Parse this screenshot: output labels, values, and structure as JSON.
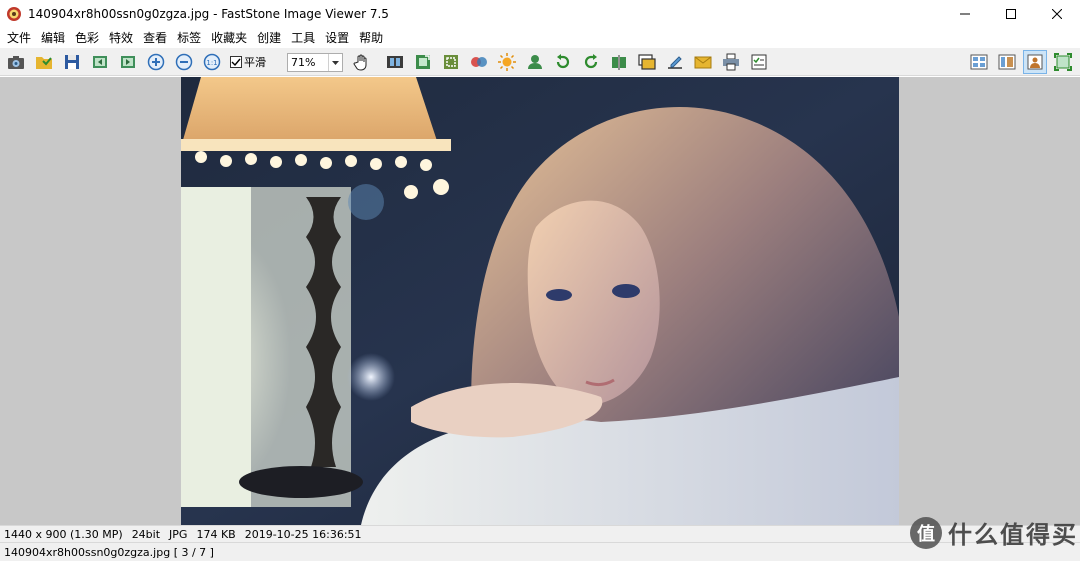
{
  "window": {
    "title": "140904xr8h00ssn0g0zgza.jpg  -  FastStone Image Viewer 7.5",
    "app_icon": "faststone-logo-icon",
    "controls": [
      "minimize-icon",
      "maximize-icon",
      "close-icon"
    ]
  },
  "menu": {
    "items": [
      "文件",
      "编辑",
      "色彩",
      "特效",
      "查看",
      "标签",
      "收藏夹",
      "创建",
      "工具",
      "设置",
      "帮助"
    ]
  },
  "toolbar": {
    "smooth_label": "平滑",
    "smooth_checked": true,
    "zoom_value": "71%"
  },
  "photo": {
    "description_icon": "photo-image"
  },
  "status": {
    "dimensions": "1440 x 900 (1.30 MP)",
    "bitdepth": "24bit",
    "format": "JPG",
    "filesize": "174 KB",
    "datetime": "2019-10-25 16:36:51",
    "file_position": "140904xr8h00ssn0g0zgza.jpg [ 3 / 7 ]"
  },
  "watermark": {
    "badge": "值",
    "text": "什么值得买"
  }
}
